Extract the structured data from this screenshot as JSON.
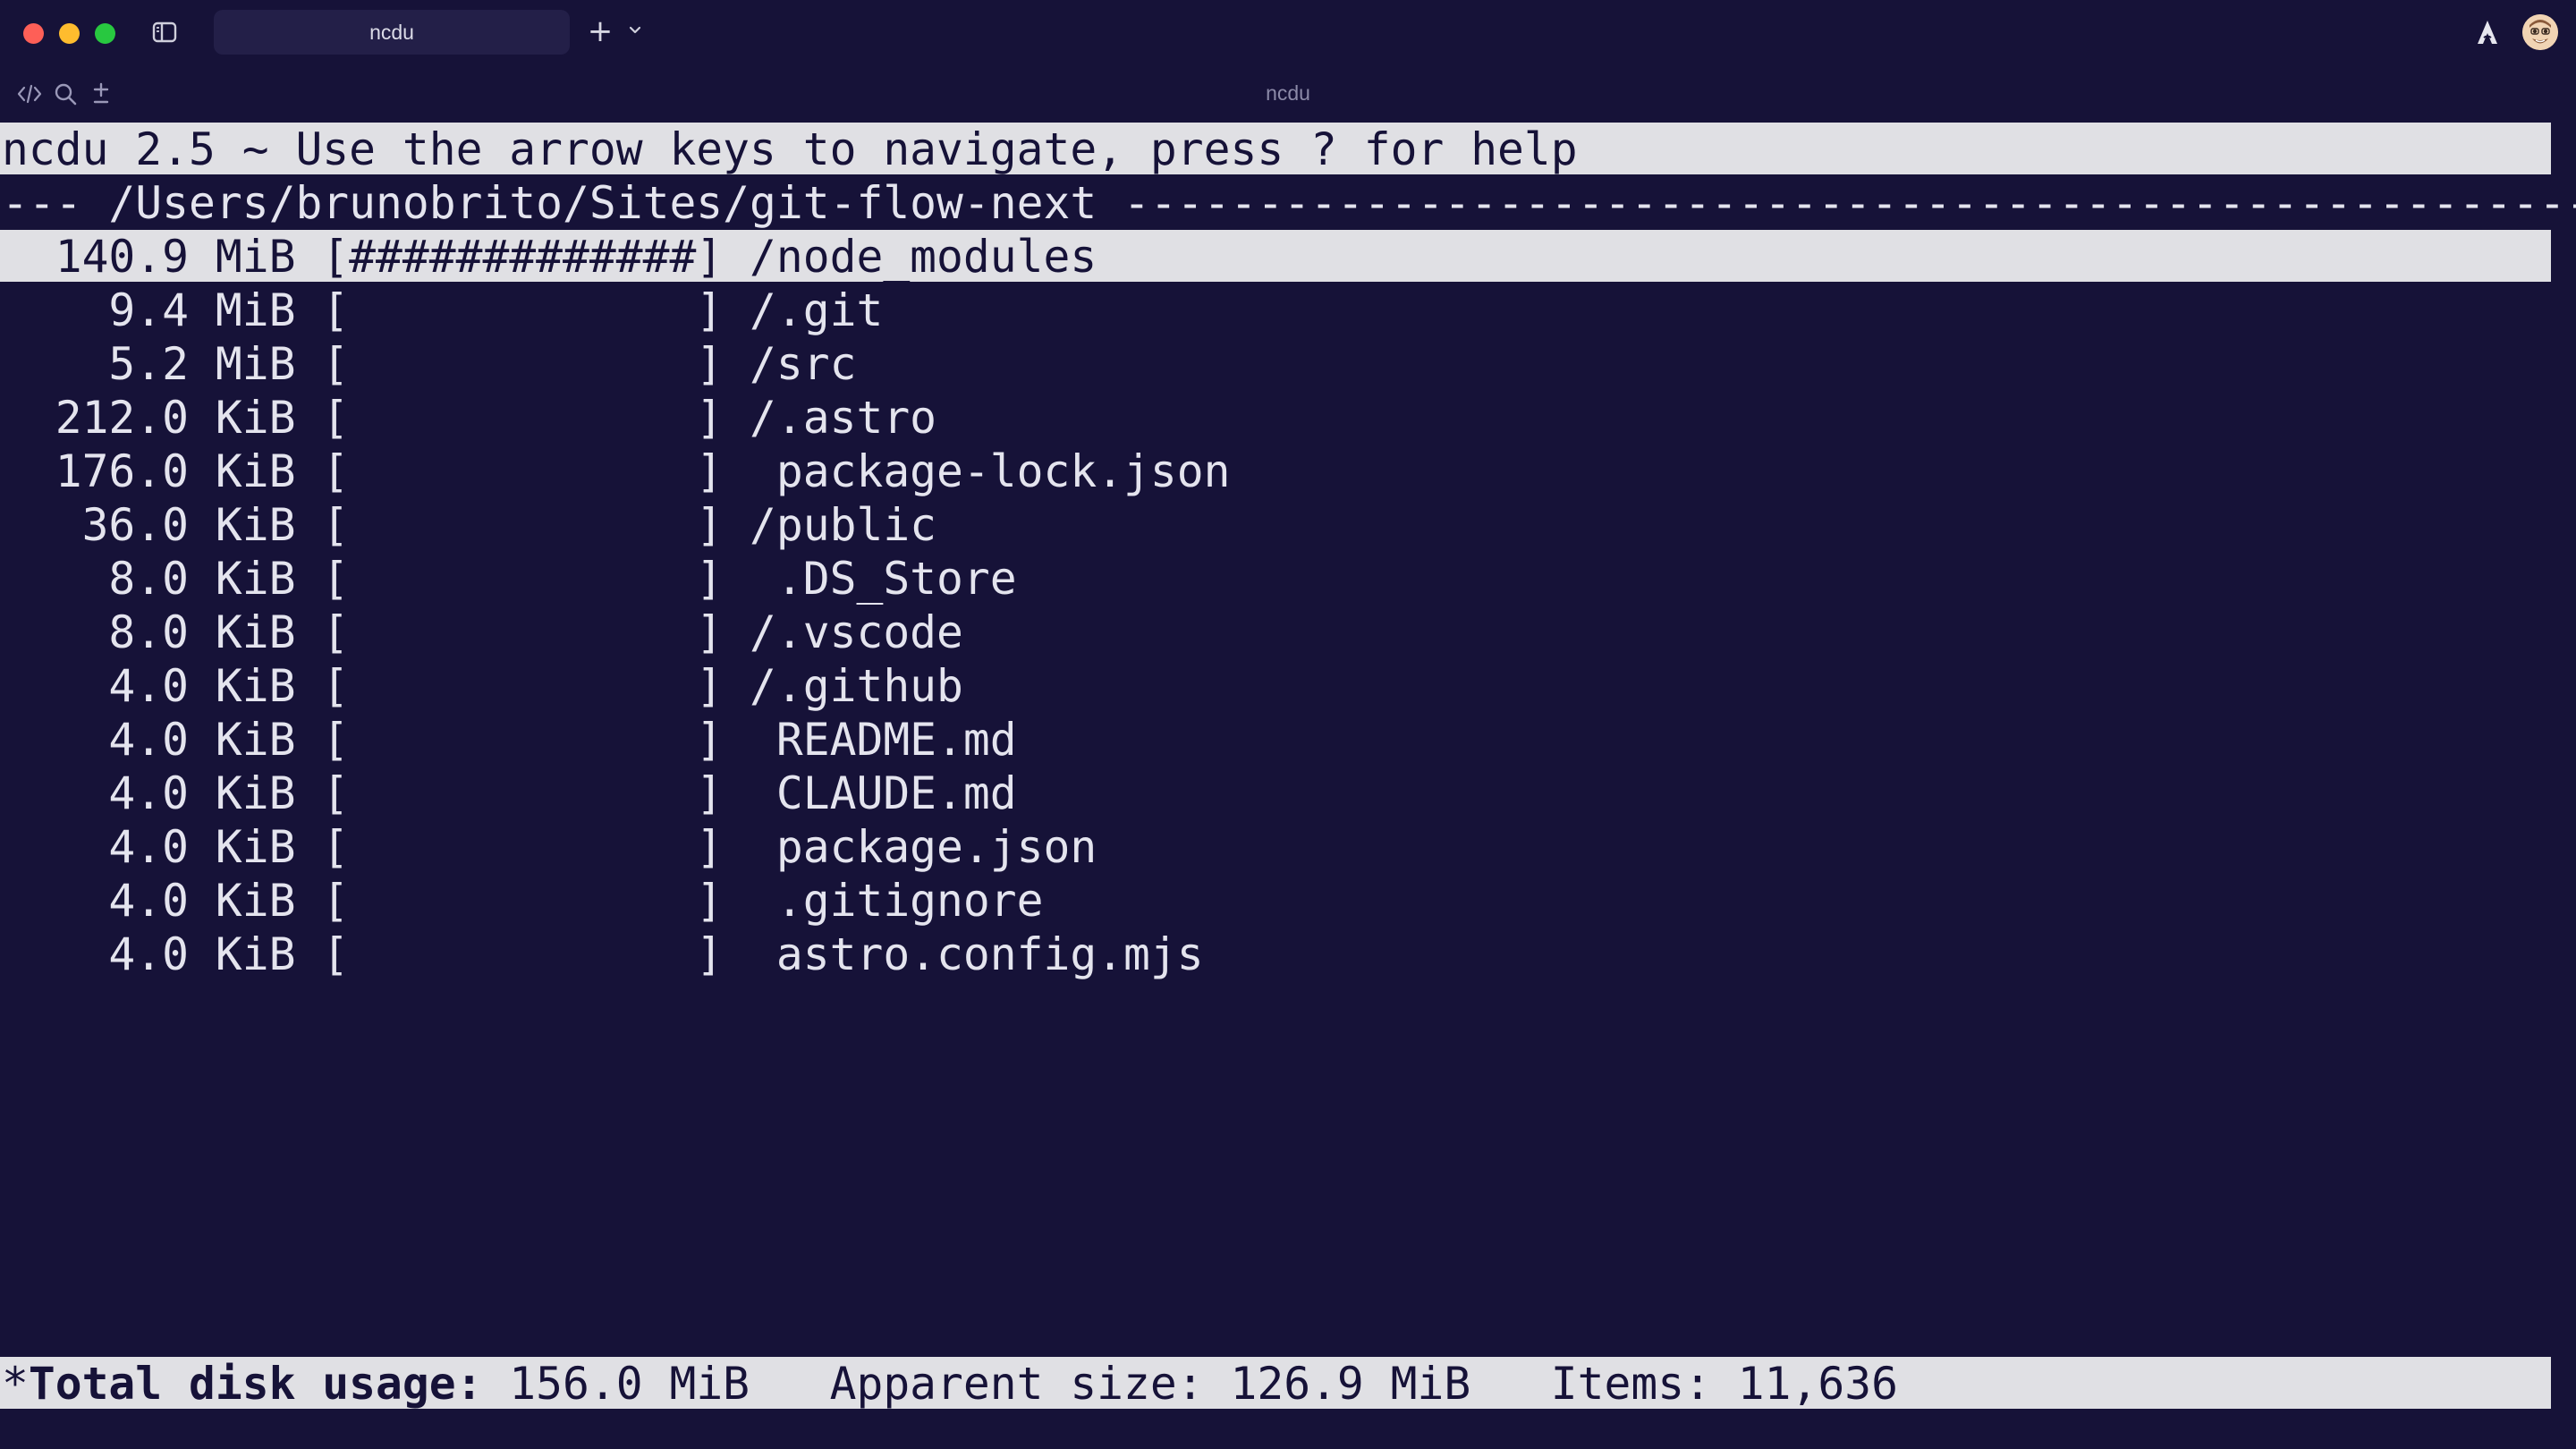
{
  "titlebar": {
    "tab_title": "ncdu",
    "new_tab_symbol": "+"
  },
  "toolbar": {
    "window_title": "ncdu",
    "icons": [
      "code-icon",
      "search-icon",
      "plus-minus-icon"
    ]
  },
  "ncdu": {
    "header": "ncdu 2.5 ~ Use the arrow keys to navigate, press ? for help",
    "path_line": "--- /Users/brunobrito/Sites/git-flow-next ---------------------------------------------------------",
    "rows": [
      "  140.9 MiB [#############] /node_modules",
      "    9.4 MiB [             ] /.git",
      "    5.2 MiB [             ] /src",
      "  212.0 KiB [             ] /.astro",
      "  176.0 KiB [             ]  package-lock.json",
      "   36.0 KiB [             ] /public",
      "    8.0 KiB [             ]  .DS_Store",
      "    8.0 KiB [             ] /.vscode",
      "    4.0 KiB [             ] /.github",
      "    4.0 KiB [             ]  README.md",
      "    4.0 KiB [             ]  CLAUDE.md",
      "    4.0 KiB [             ]  package.json",
      "    4.0 KiB [             ]  .gitignore",
      "    4.0 KiB [             ]  astro.config.mjs"
    ],
    "selected_row": 0,
    "footer": {
      "prefix": "*",
      "total_label": "Total disk usage:",
      "total_value": " 156.0 MiB   Apparent size: 126.9 MiB   Items: 11,636"
    }
  },
  "colors": {
    "background": "#161238",
    "inverse_bg": "#e0e0e4",
    "text": "#e4e4ee"
  }
}
